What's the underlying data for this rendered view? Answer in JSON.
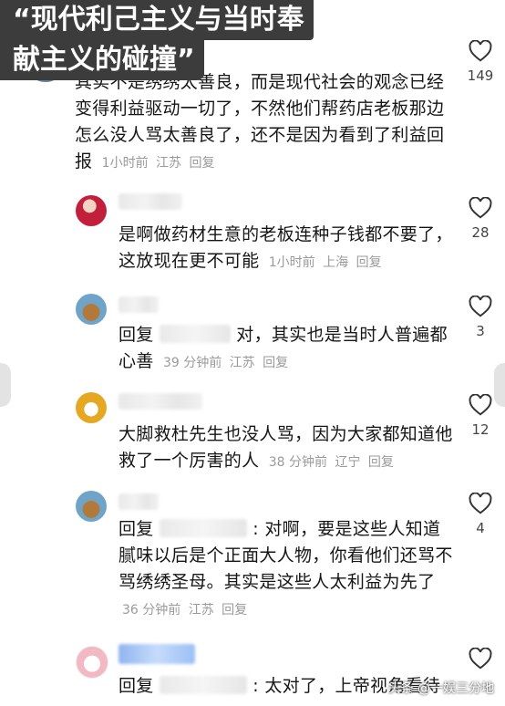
{
  "title": {
    "line1": "“现代利己主义与当时奉",
    "line2": "献主义的碰撞”"
  },
  "comments": [
    {
      "text": "其实不是绣绣太善良，而是现代社会的观念已经变得利益驱动一切了，不然他们帮药店老板那边怎么没人骂太善良了，还不是因为看到了利益回报",
      "time": "1小时前",
      "location": "江苏",
      "reply": "回复",
      "likes": "149"
    },
    {
      "text": "是啊做药材生意的老板连种子钱都不要了，这放现在更不可能",
      "time": "1小时前",
      "location": "上海",
      "reply": "回复",
      "likes": "28"
    },
    {
      "prefix": "回复",
      "text": "对，其实也是当时人普遍都心善",
      "time": "39 分钟前",
      "location": "江苏",
      "reply": "回复",
      "likes": "3"
    },
    {
      "text": "大脚救杜先生也没人骂，因为大家都知道他救了一个厉害的人",
      "time": "38 分钟前",
      "location": "辽宁",
      "reply": "回复",
      "likes": "12"
    },
    {
      "prefix": "回复",
      "text": ": 对啊，要是这些人知道腻味以后是个正面大人物，你看他们还骂不骂绣绣圣母。其实是这些人太利益为先了",
      "time": "36 分钟前",
      "location": "江苏",
      "reply": "回复",
      "likes": "4"
    },
    {
      "prefix": "回复",
      "text": ": 太对了，上帝视角看待"
    }
  ],
  "watermark": "头条 @一娱三分地",
  "colors": {
    "meta": "#9a9a9a",
    "banner": "#3c3c3c"
  }
}
